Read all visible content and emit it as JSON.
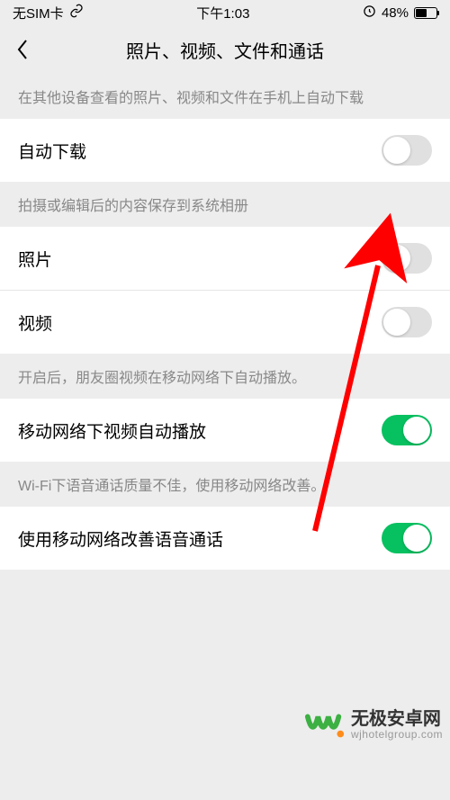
{
  "status": {
    "carrier": "无SIM卡",
    "time": "下午1:03",
    "battery_pct": "48%"
  },
  "nav": {
    "title": "照片、视频、文件和通话"
  },
  "section1": {
    "desc": "在其他设备查看的照片、视频和文件在手机上自动下载",
    "auto_download_label": "自动下载",
    "auto_download_on": false
  },
  "section2": {
    "desc": "拍摄或编辑后的内容保存到系统相册",
    "photo_label": "照片",
    "photo_on": false,
    "video_label": "视频",
    "video_on": false
  },
  "section3": {
    "desc": "开启后，朋友圈视频在移动网络下自动播放。",
    "autoplay_label": "移动网络下视频自动播放",
    "autoplay_on": true
  },
  "section4": {
    "desc": "Wi-Fi下语音通话质量不佳，使用移动网络改善。",
    "improve_label": "使用移动网络改善语音通话",
    "improve_on": true
  },
  "watermark": {
    "title": "无极安卓网",
    "sub": "wjhotelgroup.com"
  }
}
